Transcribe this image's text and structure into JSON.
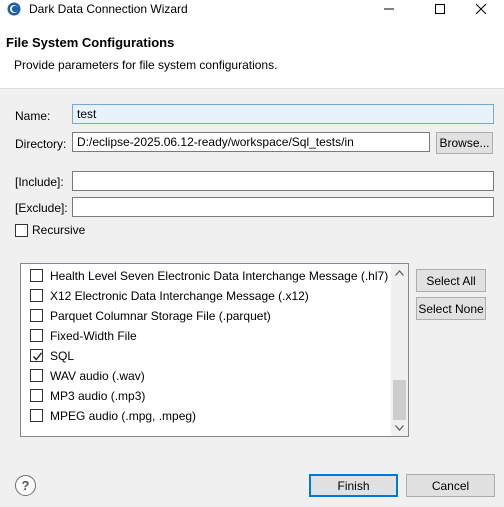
{
  "window": {
    "title": "Dark Data Connection Wizard",
    "controls": [
      "minimize-icon",
      "maximize-icon",
      "close-icon"
    ]
  },
  "header": {
    "title": "File System Configurations",
    "description": "Provide parameters for file system configurations."
  },
  "form": {
    "name_label": "Name:",
    "name_value": "test",
    "directory_label": "Directory:",
    "directory_value": "D:/eclipse-2025.06.12-ready/workspace/Sql_tests/in",
    "browse_label": "Browse...",
    "include_label": "[Include]:",
    "include_value": "",
    "exclude_label": "[Exclude]:",
    "exclude_value": "",
    "recursive_label": "Recursive",
    "recursive_checked": false
  },
  "file_types": [
    {
      "label": "Health Level Seven Electronic Data Interchange Message (.hl7)",
      "checked": false
    },
    {
      "label": "X12 Electronic Data Interchange Message (.x12)",
      "checked": false
    },
    {
      "label": "Parquet Columnar Storage File (.parquet)",
      "checked": false
    },
    {
      "label": "Fixed-Width File",
      "checked": false
    },
    {
      "label": "SQL",
      "checked": true
    },
    {
      "label": "WAV audio (.wav)",
      "checked": false
    },
    {
      "label": "MP3 audio (.mp3)",
      "checked": false
    },
    {
      "label": "MPEG audio (.mpg, .mpeg)",
      "checked": false
    }
  ],
  "side_buttons": {
    "select_all": "Select All",
    "select_none": "Select None"
  },
  "footer": {
    "help_icon": "help-icon",
    "help_glyph": "?",
    "finish_label": "Finish",
    "cancel_label": "Cancel"
  },
  "colors": {
    "accent": "#0078d7",
    "dialog_bg": "#f0f0f0",
    "name_field_bg": "#e8f2fb"
  }
}
